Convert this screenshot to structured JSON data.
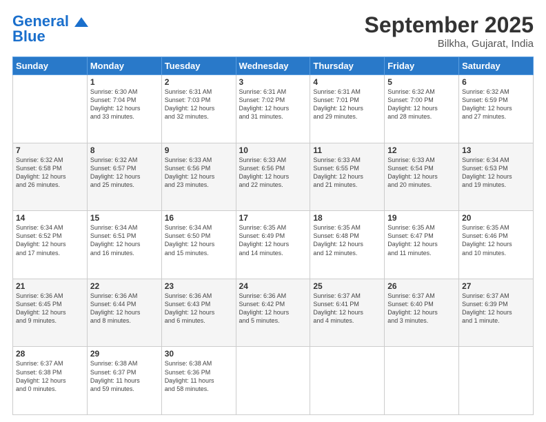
{
  "header": {
    "logo_line1": "General",
    "logo_line2": "Blue",
    "month": "September 2025",
    "location": "Bilkha, Gujarat, India"
  },
  "days_of_week": [
    "Sunday",
    "Monday",
    "Tuesday",
    "Wednesday",
    "Thursday",
    "Friday",
    "Saturday"
  ],
  "weeks": [
    [
      {
        "day": "",
        "info": ""
      },
      {
        "day": "1",
        "info": "Sunrise: 6:30 AM\nSunset: 7:04 PM\nDaylight: 12 hours\nand 33 minutes."
      },
      {
        "day": "2",
        "info": "Sunrise: 6:31 AM\nSunset: 7:03 PM\nDaylight: 12 hours\nand 32 minutes."
      },
      {
        "day": "3",
        "info": "Sunrise: 6:31 AM\nSunset: 7:02 PM\nDaylight: 12 hours\nand 31 minutes."
      },
      {
        "day": "4",
        "info": "Sunrise: 6:31 AM\nSunset: 7:01 PM\nDaylight: 12 hours\nand 29 minutes."
      },
      {
        "day": "5",
        "info": "Sunrise: 6:32 AM\nSunset: 7:00 PM\nDaylight: 12 hours\nand 28 minutes."
      },
      {
        "day": "6",
        "info": "Sunrise: 6:32 AM\nSunset: 6:59 PM\nDaylight: 12 hours\nand 27 minutes."
      }
    ],
    [
      {
        "day": "7",
        "info": "Sunrise: 6:32 AM\nSunset: 6:58 PM\nDaylight: 12 hours\nand 26 minutes."
      },
      {
        "day": "8",
        "info": "Sunrise: 6:32 AM\nSunset: 6:57 PM\nDaylight: 12 hours\nand 25 minutes."
      },
      {
        "day": "9",
        "info": "Sunrise: 6:33 AM\nSunset: 6:56 PM\nDaylight: 12 hours\nand 23 minutes."
      },
      {
        "day": "10",
        "info": "Sunrise: 6:33 AM\nSunset: 6:56 PM\nDaylight: 12 hours\nand 22 minutes."
      },
      {
        "day": "11",
        "info": "Sunrise: 6:33 AM\nSunset: 6:55 PM\nDaylight: 12 hours\nand 21 minutes."
      },
      {
        "day": "12",
        "info": "Sunrise: 6:33 AM\nSunset: 6:54 PM\nDaylight: 12 hours\nand 20 minutes."
      },
      {
        "day": "13",
        "info": "Sunrise: 6:34 AM\nSunset: 6:53 PM\nDaylight: 12 hours\nand 19 minutes."
      }
    ],
    [
      {
        "day": "14",
        "info": "Sunrise: 6:34 AM\nSunset: 6:52 PM\nDaylight: 12 hours\nand 17 minutes."
      },
      {
        "day": "15",
        "info": "Sunrise: 6:34 AM\nSunset: 6:51 PM\nDaylight: 12 hours\nand 16 minutes."
      },
      {
        "day": "16",
        "info": "Sunrise: 6:34 AM\nSunset: 6:50 PM\nDaylight: 12 hours\nand 15 minutes."
      },
      {
        "day": "17",
        "info": "Sunrise: 6:35 AM\nSunset: 6:49 PM\nDaylight: 12 hours\nand 14 minutes."
      },
      {
        "day": "18",
        "info": "Sunrise: 6:35 AM\nSunset: 6:48 PM\nDaylight: 12 hours\nand 12 minutes."
      },
      {
        "day": "19",
        "info": "Sunrise: 6:35 AM\nSunset: 6:47 PM\nDaylight: 12 hours\nand 11 minutes."
      },
      {
        "day": "20",
        "info": "Sunrise: 6:35 AM\nSunset: 6:46 PM\nDaylight: 12 hours\nand 10 minutes."
      }
    ],
    [
      {
        "day": "21",
        "info": "Sunrise: 6:36 AM\nSunset: 6:45 PM\nDaylight: 12 hours\nand 9 minutes."
      },
      {
        "day": "22",
        "info": "Sunrise: 6:36 AM\nSunset: 6:44 PM\nDaylight: 12 hours\nand 8 minutes."
      },
      {
        "day": "23",
        "info": "Sunrise: 6:36 AM\nSunset: 6:43 PM\nDaylight: 12 hours\nand 6 minutes."
      },
      {
        "day": "24",
        "info": "Sunrise: 6:36 AM\nSunset: 6:42 PM\nDaylight: 12 hours\nand 5 minutes."
      },
      {
        "day": "25",
        "info": "Sunrise: 6:37 AM\nSunset: 6:41 PM\nDaylight: 12 hours\nand 4 minutes."
      },
      {
        "day": "26",
        "info": "Sunrise: 6:37 AM\nSunset: 6:40 PM\nDaylight: 12 hours\nand 3 minutes."
      },
      {
        "day": "27",
        "info": "Sunrise: 6:37 AM\nSunset: 6:39 PM\nDaylight: 12 hours\nand 1 minute."
      }
    ],
    [
      {
        "day": "28",
        "info": "Sunrise: 6:37 AM\nSunset: 6:38 PM\nDaylight: 12 hours\nand 0 minutes."
      },
      {
        "day": "29",
        "info": "Sunrise: 6:38 AM\nSunset: 6:37 PM\nDaylight: 11 hours\nand 59 minutes."
      },
      {
        "day": "30",
        "info": "Sunrise: 6:38 AM\nSunset: 6:36 PM\nDaylight: 11 hours\nand 58 minutes."
      },
      {
        "day": "",
        "info": ""
      },
      {
        "day": "",
        "info": ""
      },
      {
        "day": "",
        "info": ""
      },
      {
        "day": "",
        "info": ""
      }
    ]
  ]
}
